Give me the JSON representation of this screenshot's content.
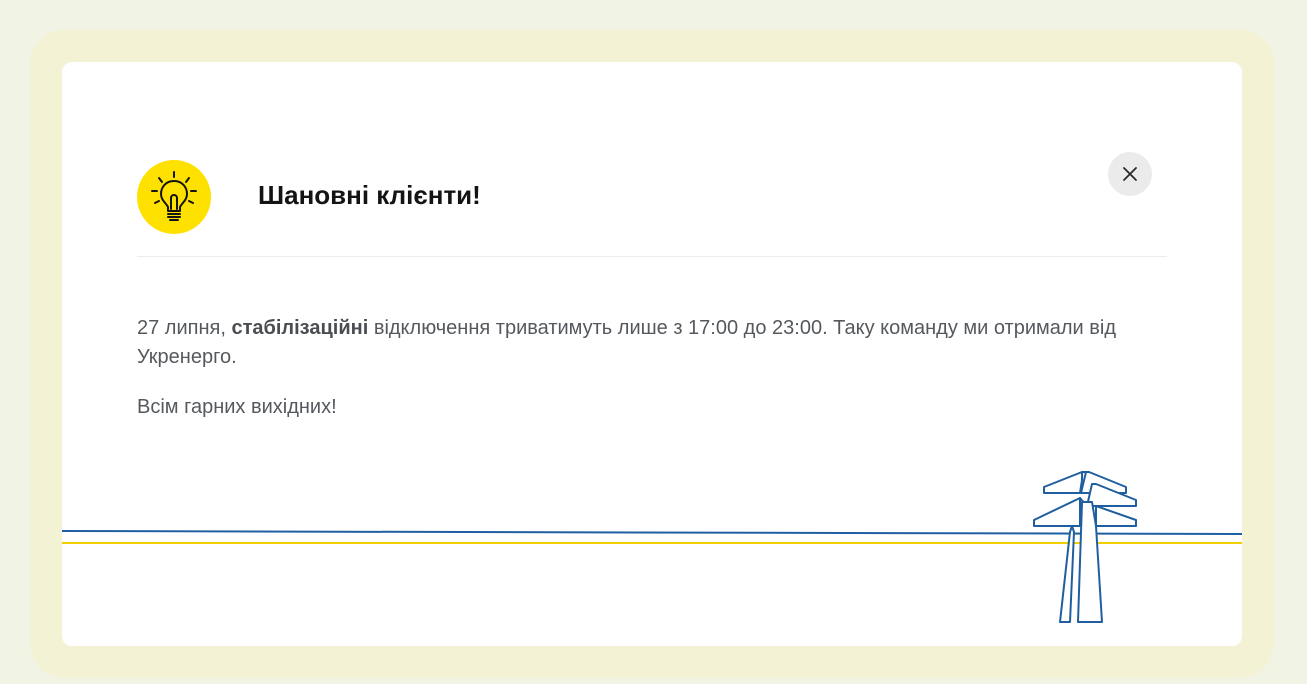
{
  "notice": {
    "title": "Шановні клієнти!",
    "paragraph1": {
      "prefix": "27 липня, ",
      "emphasis": "стабілізаційні",
      "suffix": " відключення триватимуть лише з 17:00 до 23:00. Таку команду ми отримали від Укренерго."
    },
    "paragraph2": "Всім гарних вихідних!",
    "icon": "lightbulb-icon",
    "close_icon": "close-icon"
  },
  "colors": {
    "accent_yellow": "#ffe100",
    "line_blue": "#1f5fa0",
    "line_yellow": "#f2cf00",
    "text": "#55595e",
    "title": "#141414"
  }
}
